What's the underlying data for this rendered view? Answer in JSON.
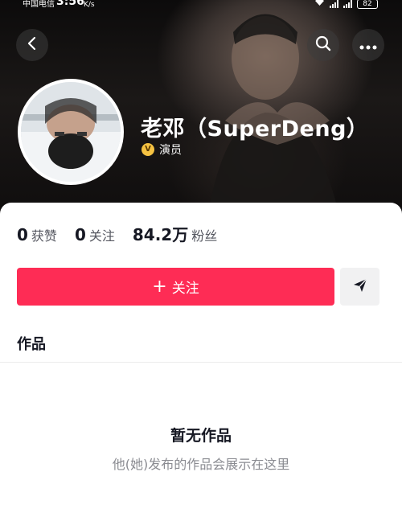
{
  "status_bar": {
    "carrier": "中国电信",
    "time": "3:56",
    "speed": "K/s",
    "battery": "82"
  },
  "nav": {
    "back_icon": "chevron-left-icon",
    "search_icon": "search-icon",
    "more_icon": "more-horizontal-icon"
  },
  "profile": {
    "name": "老邓（SuperDeng）",
    "verify_badge": "V",
    "verify_label": "演员"
  },
  "stats": [
    {
      "value": "0",
      "label": "获赞"
    },
    {
      "value": "0",
      "label": "关注"
    },
    {
      "value": "84.2万",
      "label": "粉丝"
    }
  ],
  "actions": {
    "follow_plus": "+",
    "follow_label": "关注",
    "share_icon": "send-icon"
  },
  "tabs": {
    "works": "作品"
  },
  "empty": {
    "title": "暂无作品",
    "subtitle": "他(她)发布的作品会展示在这里"
  },
  "colors": {
    "accent": "#fe2c55",
    "badge": "#f5c242"
  }
}
